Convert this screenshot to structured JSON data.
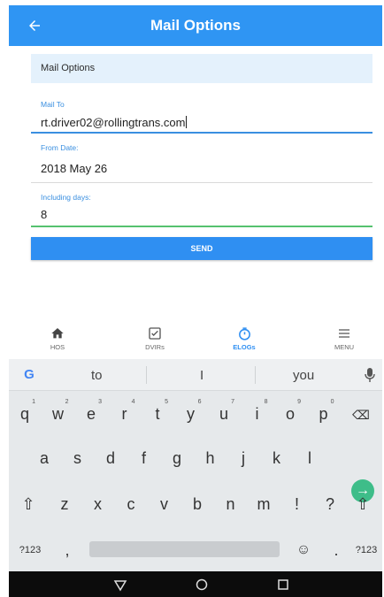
{
  "appbar": {
    "title": "Mail Options",
    "back_icon": "arrow-left-icon"
  },
  "form": {
    "section_title": "Mail Options",
    "mail_to": {
      "label": "Mail To",
      "value": "rt.driver02@rollingtrans.com"
    },
    "from_date": {
      "label": "From Date:",
      "value": "2018 May 26"
    },
    "including_days": {
      "label": "Including days:",
      "value": "8"
    },
    "send_label": "SEND"
  },
  "bottom_nav": [
    {
      "label": "HOS",
      "icon": "home-icon"
    },
    {
      "label": "DVIRs",
      "icon": "checkbox-icon"
    },
    {
      "label": "ELOGs",
      "icon": "timer-icon",
      "active": true
    },
    {
      "label": "MENU",
      "icon": "menu-icon"
    }
  ],
  "keyboard": {
    "suggestions": [
      "to",
      "I",
      "you"
    ],
    "row1": [
      "q",
      "w",
      "e",
      "r",
      "t",
      "y",
      "u",
      "i",
      "o",
      "p"
    ],
    "row1_hints": [
      "1",
      "2",
      "3",
      "4",
      "5",
      "6",
      "7",
      "8",
      "9",
      "0"
    ],
    "row2": [
      "a",
      "s",
      "d",
      "f",
      "g",
      "h",
      "j",
      "k",
      "l"
    ],
    "row3": [
      "z",
      "x",
      "c",
      "v",
      "b",
      "n",
      "m",
      "!",
      "?"
    ],
    "row4": {
      "symbols": "?123",
      "comma": ",",
      "period": ".",
      "symbols_right": "?123"
    }
  },
  "colors": {
    "primary": "#2f95f3",
    "accent_green": "#3ebd89",
    "keyboard_bg": "#e6e9eb"
  }
}
